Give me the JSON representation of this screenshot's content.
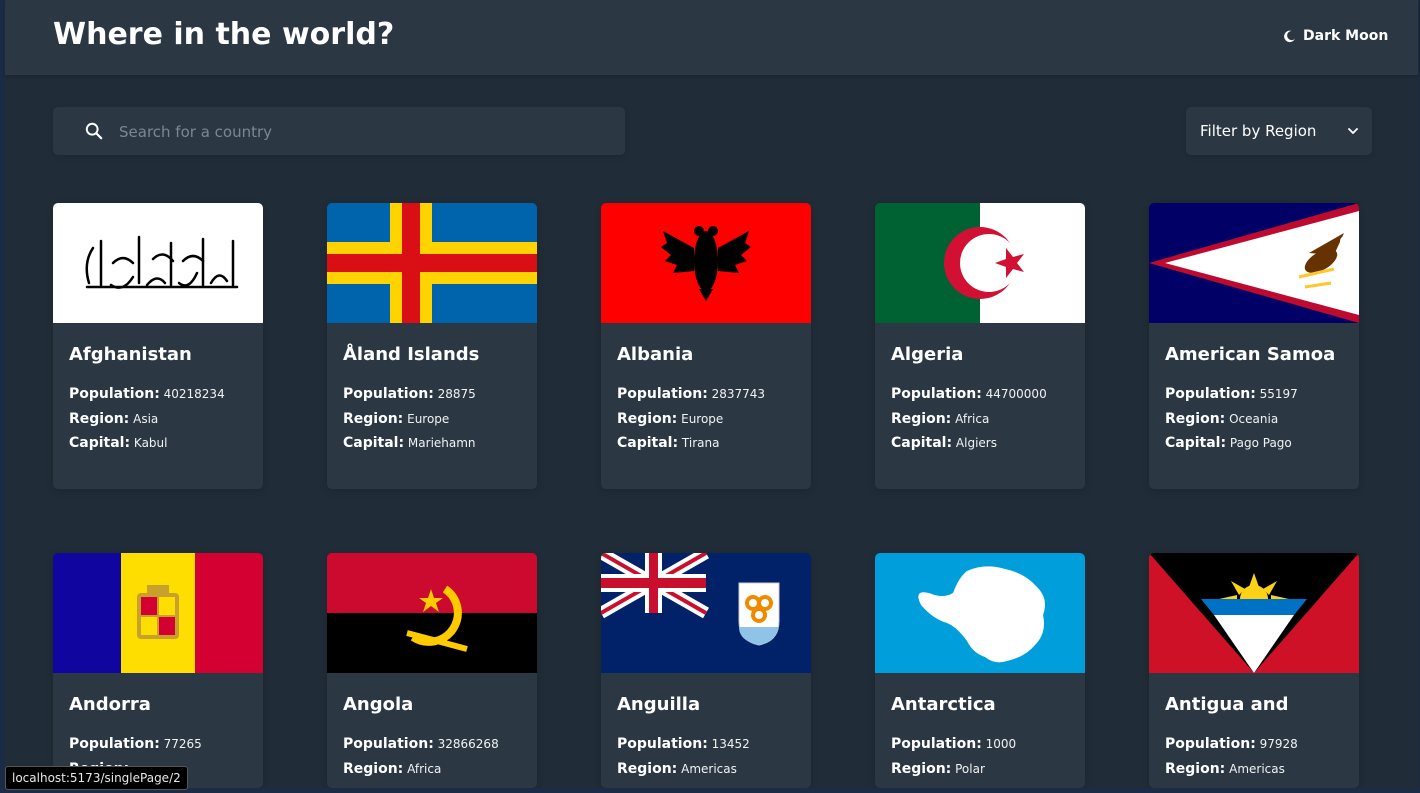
{
  "header": {
    "title": "Where in the world?",
    "theme_label": "Dark Moon"
  },
  "search": {
    "placeholder": "Search for a country"
  },
  "filter": {
    "label": "Filter by Region"
  },
  "labels": {
    "population": "Population:",
    "region": "Region:",
    "capital": "Capital:"
  },
  "countries": [
    {
      "name": "Afghanistan",
      "population": "40218234",
      "region": "Asia",
      "capital": "Kabul"
    },
    {
      "name": "Åland Islands",
      "population": "28875",
      "region": "Europe",
      "capital": "Mariehamn"
    },
    {
      "name": "Albania",
      "population": "2837743",
      "region": "Europe",
      "capital": "Tirana"
    },
    {
      "name": "Algeria",
      "population": "44700000",
      "region": "Africa",
      "capital": "Algiers"
    },
    {
      "name": "American Samoa",
      "population": "55197",
      "region": "Oceania",
      "capital": "Pago Pago"
    },
    {
      "name": "Andorra",
      "population": "77265",
      "region": "",
      "capital": ""
    },
    {
      "name": "Angola",
      "population": "32866268",
      "region": "Africa",
      "capital": ""
    },
    {
      "name": "Anguilla",
      "population": "13452",
      "region": "Americas",
      "capital": ""
    },
    {
      "name": "Antarctica",
      "population": "1000",
      "region": "Polar",
      "capital": ""
    },
    {
      "name": "Antigua and",
      "population": "97928",
      "region": "Americas",
      "capital": ""
    }
  ],
  "status_bar": {
    "url": "localhost:5173/singlePage/2"
  },
  "colors": {
    "background": "#202c37",
    "element": "#2b3844",
    "text": "#ffffff"
  }
}
